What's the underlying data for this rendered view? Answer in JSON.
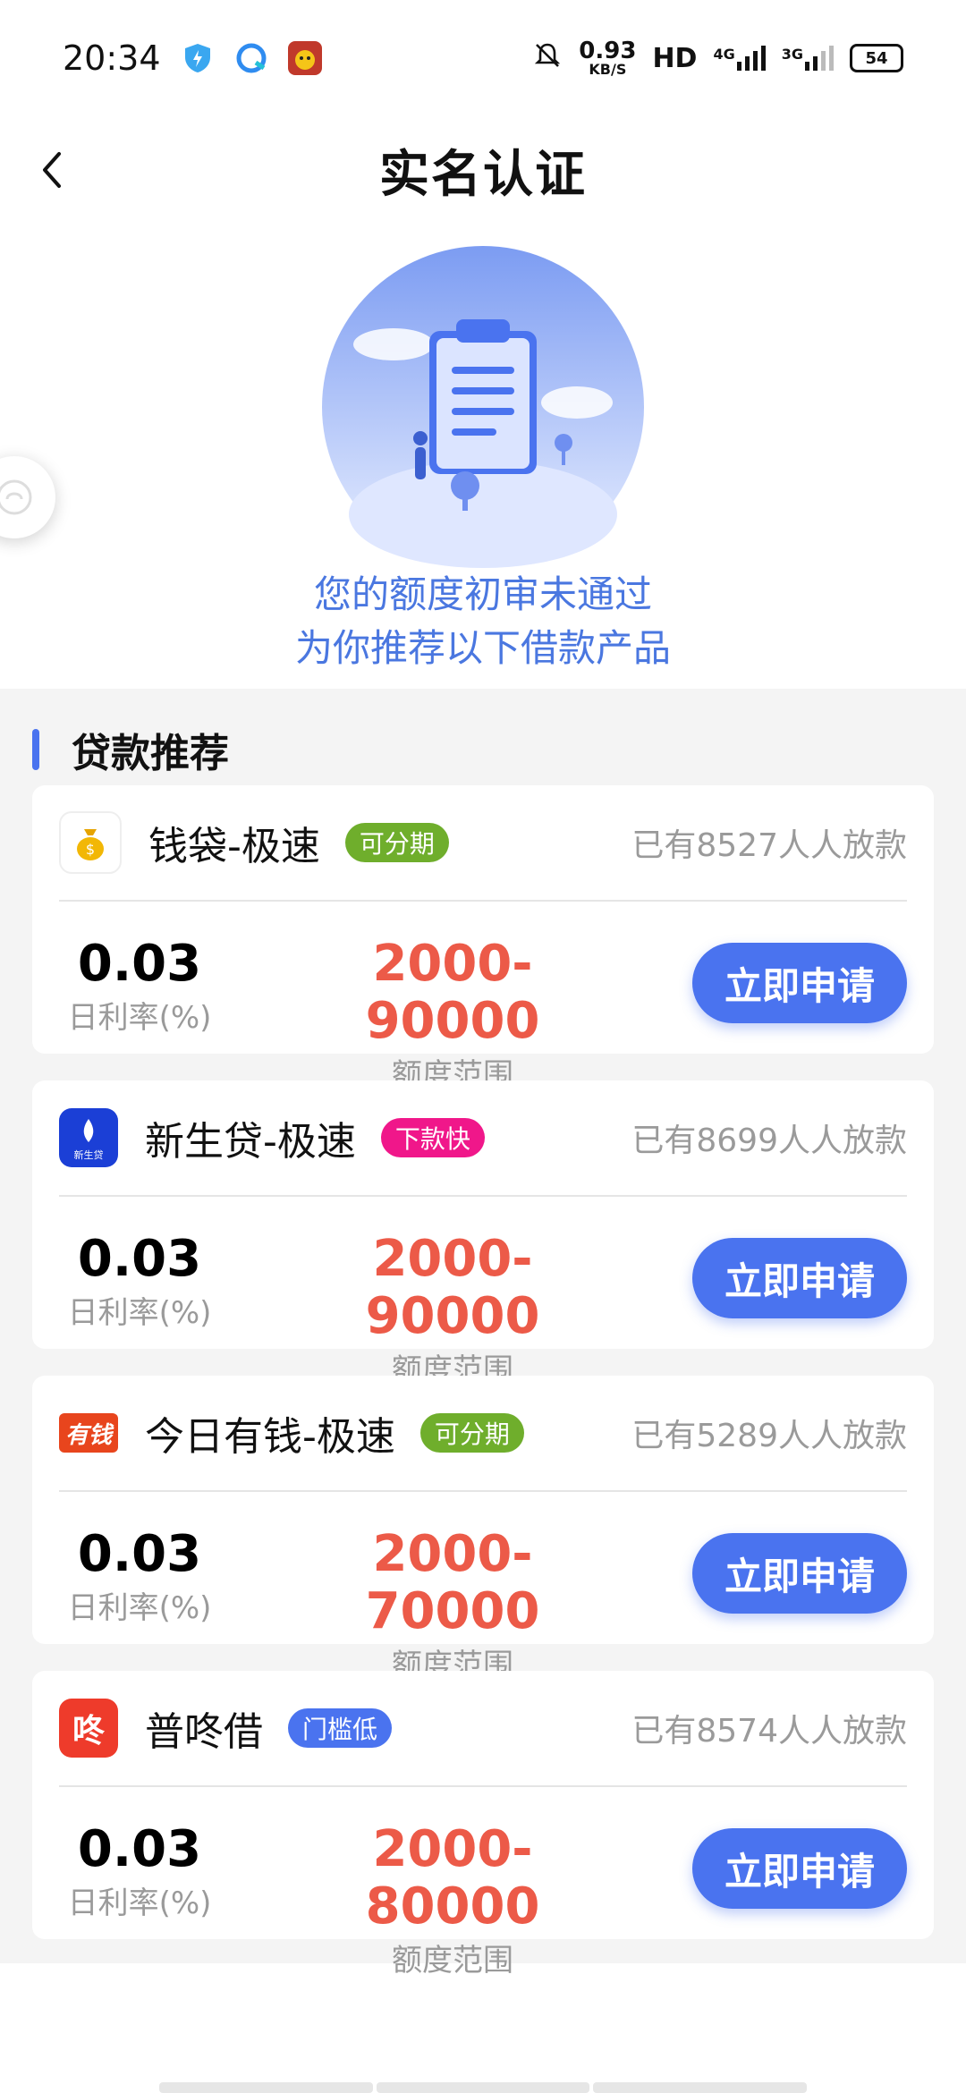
{
  "status_bar": {
    "time": "20:34",
    "net_speed_value": "0.93",
    "net_speed_unit": "KB/S",
    "hd_label": "HD",
    "signal_1": "4G",
    "signal_2": "3G",
    "battery": "54",
    "icons": [
      "security-shield-icon",
      "browser-icon",
      "game-app-icon",
      "bell-muted-icon",
      "signal-4g-icon",
      "signal-3g-icon",
      "battery-icon"
    ]
  },
  "nav": {
    "title": "实名认证"
  },
  "hero": {
    "line1": "您的额度初审未通过",
    "line2": "为你推荐以下借款产品",
    "text_color": "#4a77e0"
  },
  "section": {
    "title": "贷款推荐"
  },
  "cards": [
    {
      "name": "钱袋-极速",
      "tag": "可分期",
      "tag_color": "#6fae2c",
      "borrowers": "已有8527人人放款",
      "rate": "0.03",
      "rate_label": "日利率(%)",
      "range": "2000-90000",
      "range_label": "额度范围",
      "button": "立即申请",
      "logo_text": "$"
    },
    {
      "name": "新生贷-极速",
      "tag": "下款快",
      "tag_color": "#f0178a",
      "borrowers": "已有8699人人放款",
      "rate": "0.03",
      "rate_label": "日利率(%)",
      "range": "2000-90000",
      "range_label": "额度范围",
      "button": "立即申请",
      "logo_text": "新生贷"
    },
    {
      "name": "今日有钱-极速",
      "tag": "可分期",
      "tag_color": "#6fae2c",
      "borrowers": "已有5289人人放款",
      "rate": "0.03",
      "rate_label": "日利率(%)",
      "range": "2000-70000",
      "range_label": "额度范围",
      "button": "立即申请",
      "logo_text": "有钱"
    },
    {
      "name": "普咚借",
      "tag": "门槛低",
      "tag_color": "#4a73ef",
      "borrowers": "已有8574人人放款",
      "rate": "0.03",
      "rate_label": "日利率(%)",
      "range": "2000-80000",
      "range_label": "额度范围",
      "button": "立即申请",
      "logo_text": "咚"
    }
  ],
  "colors": {
    "accent": "#4a73ef",
    "range_red": "#ec5a48",
    "muted": "#9a9a9a",
    "page_gray": "#f4f4f4"
  }
}
